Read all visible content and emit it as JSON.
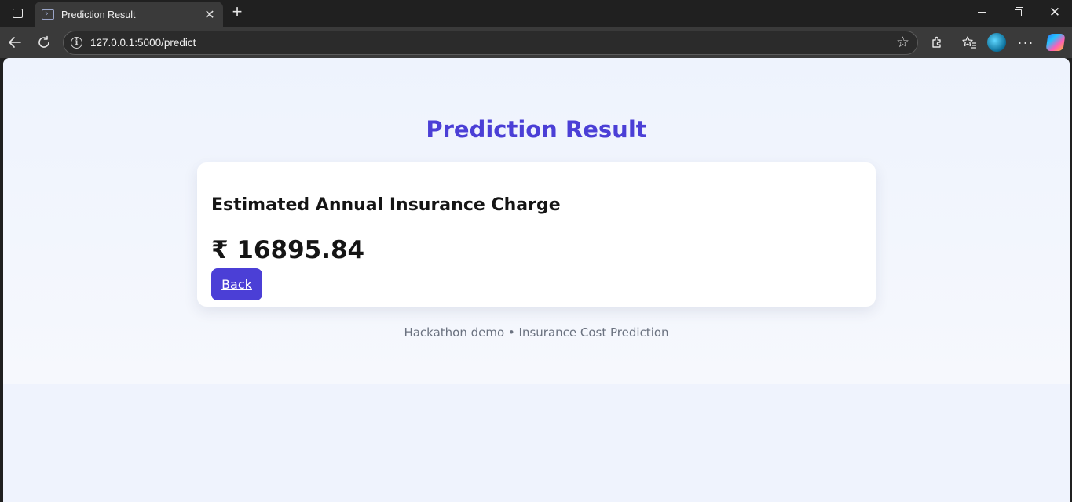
{
  "browser": {
    "tab_title": "Prediction Result",
    "url": "127.0.0.1:5000/predict"
  },
  "page": {
    "title": "Prediction Result",
    "card": {
      "heading": "Estimated Annual Insurance Charge",
      "amount": "₹ 16895.84",
      "back_label": "Back"
    },
    "footer": "Hackathon demo • Insurance Cost Prediction"
  },
  "colors": {
    "accent": "#4b3fd6",
    "page_background": "#eff3fd",
    "card_background": "#ffffff",
    "footer_text": "#6b7280"
  }
}
